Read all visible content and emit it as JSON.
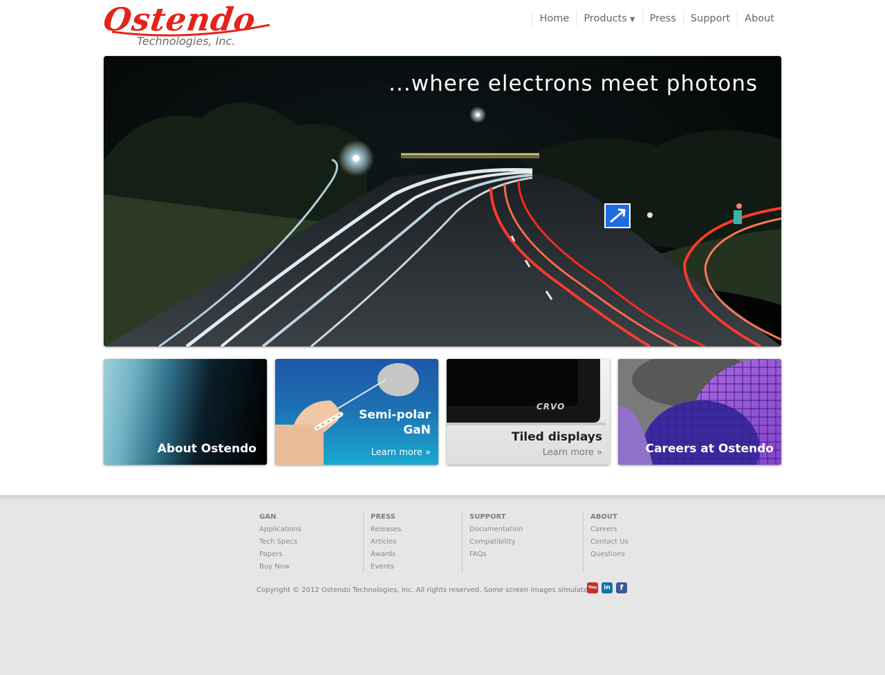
{
  "logo": {
    "name": "Ostendo",
    "subtitle": "Technologies, Inc."
  },
  "nav": {
    "items": [
      {
        "label": "Home"
      },
      {
        "label": "Products",
        "caret": "▼"
      },
      {
        "label": "Press"
      },
      {
        "label": "Support"
      },
      {
        "label": "About"
      }
    ]
  },
  "hero": {
    "tagline": "...where electrons meet photons"
  },
  "tiles": [
    {
      "title": "About Ostendo"
    },
    {
      "title_line1": "Semi-polar",
      "title_line2": "GaN",
      "link": "Learn more »"
    },
    {
      "brand": "CRVO",
      "title": "Tiled displays",
      "link": "Learn more »"
    },
    {
      "title": "Careers at Ostendo"
    }
  ],
  "footer": {
    "columns": [
      {
        "heading": "GAN",
        "links": [
          "Applications",
          "Tech Specs",
          "Papers",
          "Buy Now"
        ]
      },
      {
        "heading": "PRESS",
        "links": [
          "Releases",
          "Articles",
          "Awards",
          "Events"
        ]
      },
      {
        "heading": "SUPPORT",
        "links": [
          "Documentation",
          "Compatibility",
          "FAQs"
        ]
      },
      {
        "heading": "ABOUT",
        "links": [
          "Careers",
          "Contact Us",
          "Questions"
        ]
      }
    ],
    "copyright": "Copyright © 2012 Ostendo Technologies, Inc. All rights reserved. Some screen images simulated.",
    "social": [
      {
        "name": "youtube-icon",
        "glyph": "You",
        "color": "#c4302b"
      },
      {
        "name": "linkedin-icon",
        "glyph": "in",
        "color": "#0e76a8"
      },
      {
        "name": "facebook-icon",
        "glyph": "f",
        "color": "#3b5998"
      }
    ]
  },
  "colors": {
    "brand_red": "#e3241c",
    "footer_bg": "#e6e6e6"
  }
}
